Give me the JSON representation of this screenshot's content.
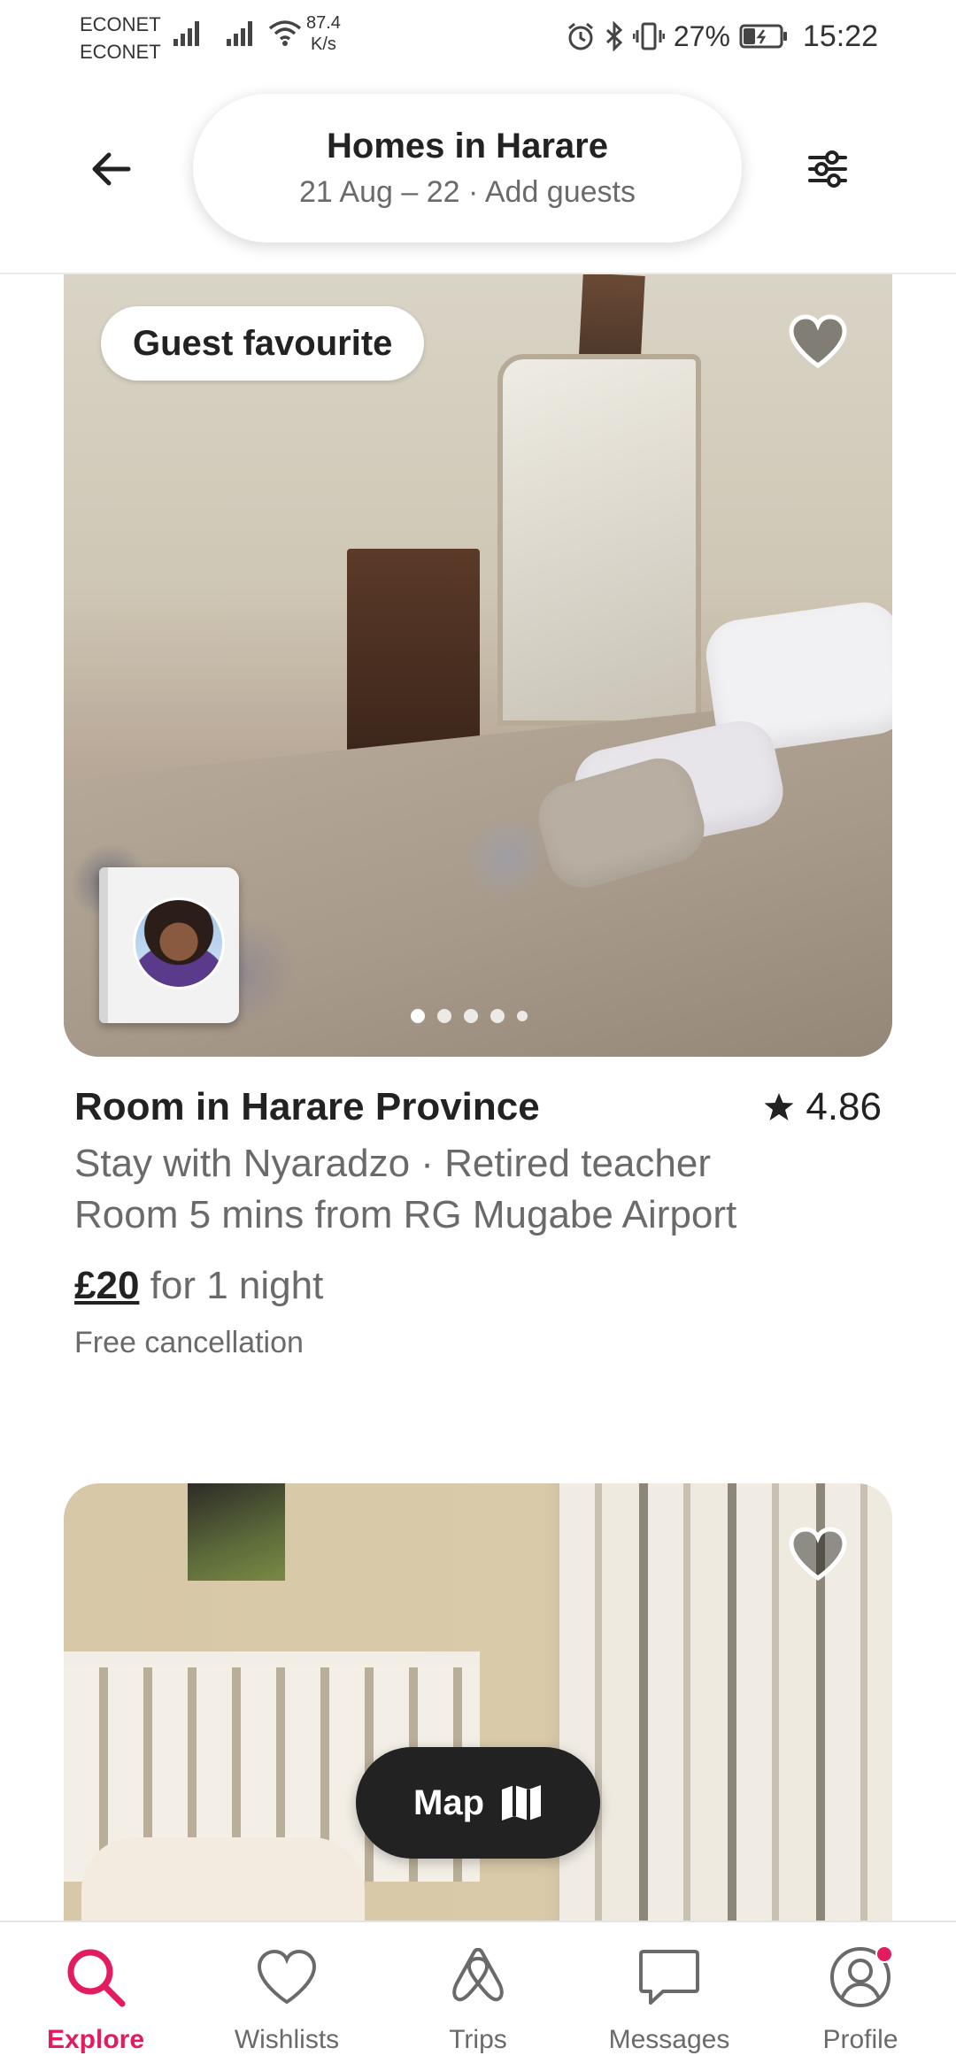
{
  "status_bar": {
    "carrier1": "ECONET",
    "carrier2": "ECONET",
    "speed_value": "87.4",
    "speed_unit": "K/s",
    "battery": "27%",
    "time": "15:22"
  },
  "header": {
    "title": "Homes in Harare",
    "subtitle": "21 Aug – 22 · Add guests"
  },
  "listing1": {
    "badge": "Guest favourite",
    "title": "Room in Harare Province",
    "rating": "4.86",
    "description1": "Stay with Nyaradzo · Retired teacher",
    "description2": "Room 5 mins from RG Mugabe Airport",
    "price": "£20",
    "price_suffix": " for 1 night",
    "cancellation": "Free cancellation",
    "photo_count": 5,
    "active_photo": 1
  },
  "map_button": {
    "label": "Map"
  },
  "bottom_nav": {
    "items": [
      {
        "label": "Explore",
        "icon": "search-icon",
        "active": true
      },
      {
        "label": "Wishlists",
        "icon": "heart-icon",
        "active": false
      },
      {
        "label": "Trips",
        "icon": "airbnb-logo-icon",
        "active": false
      },
      {
        "label": "Messages",
        "icon": "message-icon",
        "active": false
      },
      {
        "label": "Profile",
        "icon": "profile-icon",
        "active": false
      }
    ]
  },
  "colors": {
    "accent": "#e31c5f",
    "text": "#222222",
    "muted": "#6a6a6a"
  }
}
